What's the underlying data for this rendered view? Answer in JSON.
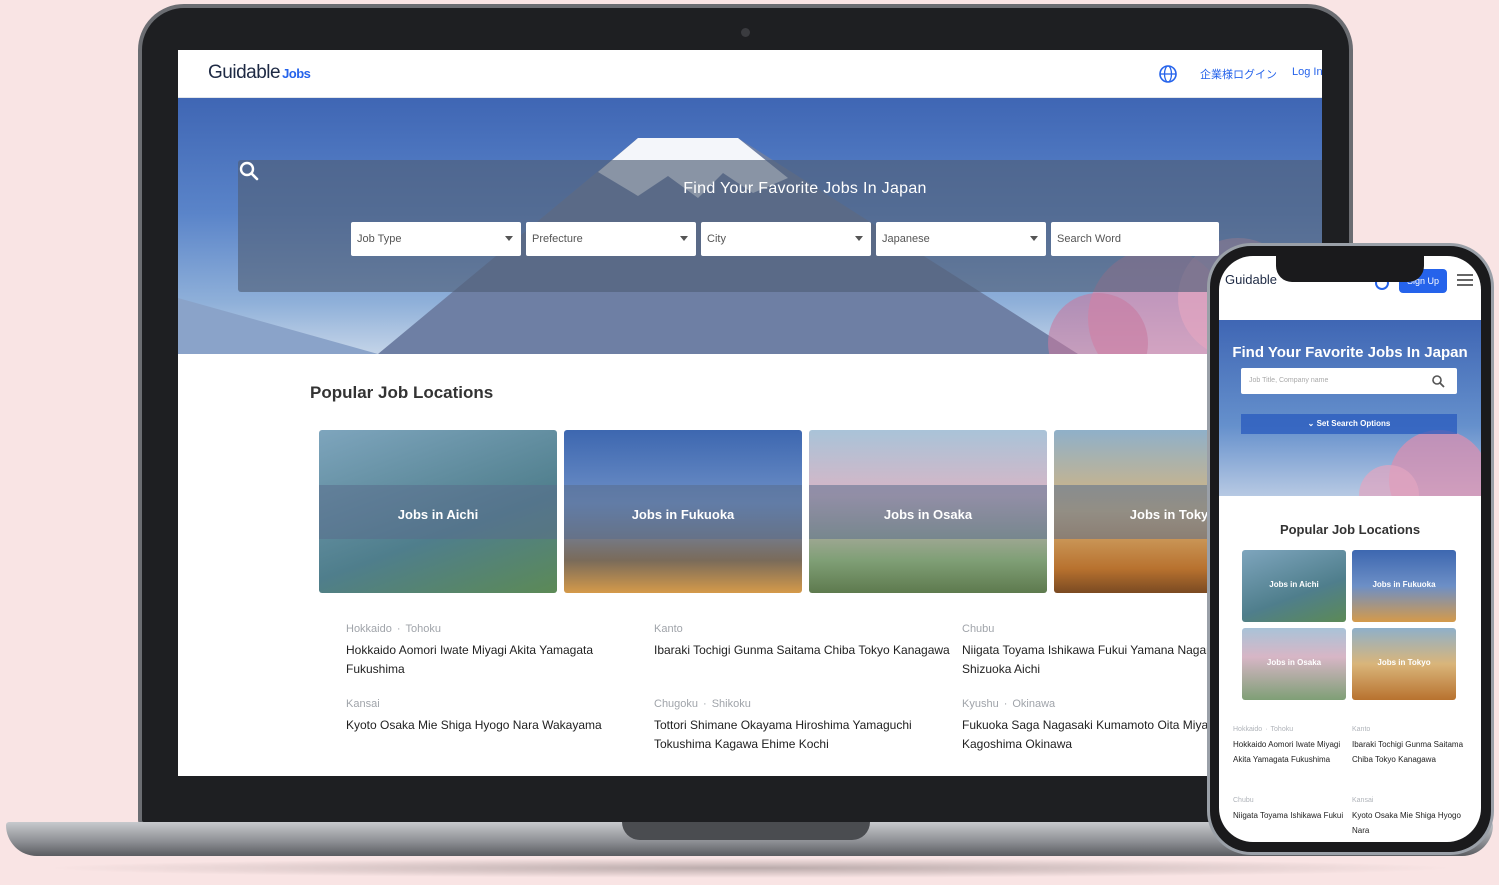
{
  "header": {
    "logo_text": "Guidable",
    "logo_suffix": "Jobs",
    "nav_business_login": "企業様ログイン",
    "nav_login": "Log In",
    "globe_icon": "globe-icon"
  },
  "hero": {
    "title": "Find Your Favorite Jobs In Japan",
    "selects": [
      {
        "label": "Job Type"
      },
      {
        "label": "Prefecture"
      },
      {
        "label": "City"
      },
      {
        "label": "Japanese"
      }
    ],
    "search_placeholder": "Search Word",
    "search_icon": "search-icon"
  },
  "popular": {
    "title": "Popular Job Locations",
    "cards": [
      {
        "label": "Jobs in Aichi",
        "color": "#5f8fa8"
      },
      {
        "label": "Jobs in Fukuoka",
        "color": "#4f79b4"
      },
      {
        "label": "Jobs in Osaka",
        "color": "#8ea6a0"
      },
      {
        "label": "Jobs in Tokyo",
        "color": "#c68a4a"
      }
    ]
  },
  "regions": [
    {
      "name_a": "Hokkaido",
      "name_b": "Tohoku",
      "prefs": "Hokkaido Aomori Iwate Miyagi Akita Yamagata Fukushima"
    },
    {
      "name_a": "Kanto",
      "name_b": "",
      "prefs": "Ibaraki Tochigi Gunma Saitama Chiba Tokyo Kanagawa"
    },
    {
      "name_a": "Chubu",
      "name_b": "",
      "prefs": "Niigata Toyama Ishikawa Fukui Yamana Nagano Gifu Shizuoka Aichi"
    },
    {
      "name_a": "Kansai",
      "name_b": "",
      "prefs": "Kyoto Osaka Mie Shiga Hyogo Nara Wakayama"
    },
    {
      "name_a": "Chugoku",
      "name_b": "Shikoku",
      "prefs": "Tottori Shimane Okayama Hiroshima Yamaguchi Tokushima Kagawa Ehime Kochi"
    },
    {
      "name_a": "Kyushu",
      "name_b": "Okinawa",
      "prefs": "Fukuoka Saga Nagasaki Kumamoto Oita Miyazaki Kagoshima Okinawa"
    }
  ],
  "mobile": {
    "logo_text": "Guidable",
    "signup_label": "Sign Up",
    "hero_title": "Find Your Favorite Jobs In Japan",
    "search_placeholder": "Job Title, Company name",
    "options_label": "Set Search Options",
    "popular_title": "Popular Job Locations",
    "cards": [
      {
        "label": "Jobs in Aichi"
      },
      {
        "label": "Jobs in Fukuoka"
      },
      {
        "label": "Jobs in Osaka"
      },
      {
        "label": "Jobs in Tokyo"
      }
    ],
    "regions": [
      {
        "name_a": "Hokkaido",
        "name_b": "Tohoku",
        "prefs": "Hokkaido Aomori Iwate Miyagi Akita Yamagata Fukushima"
      },
      {
        "name_a": "Kanto",
        "name_b": "",
        "prefs": "Ibaraki Tochigi Gunma Saitama Chiba Tokyo Kanagawa"
      },
      {
        "name_a": "Chubu",
        "name_b": "",
        "prefs": "Niigata Toyama Ishikawa Fukui"
      },
      {
        "name_a": "Kansai",
        "name_b": "",
        "prefs": "Kyoto Osaka Mie Shiga Hyogo Nara"
      }
    ]
  }
}
